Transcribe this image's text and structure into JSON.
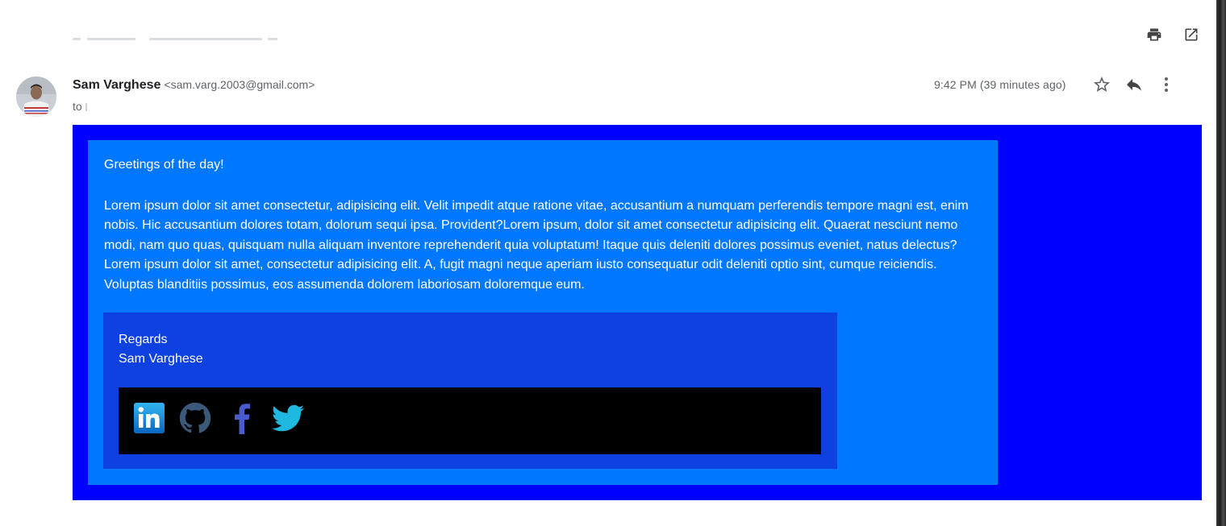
{
  "sender": {
    "name": "Sam Varghese",
    "email": "<sam.varg.2003@gmail.com>",
    "to_label": "to"
  },
  "timestamp": "9:42 PM (39 minutes ago)",
  "toolbar": {
    "print_icon": "print-icon",
    "open_new_window_icon": "open-in-new-window-icon",
    "star_icon": "star-outline-icon",
    "reply_icon": "reply-icon",
    "more_icon": "more-vertical-icon"
  },
  "email": {
    "greeting": "Greetings of the day!",
    "paragraph": "Lorem ipsum dolor sit amet consectetur, adipisicing elit. Velit impedit atque ratione vitae, accusantium a numquam perferendis tempore magni est, enim nobis. Hic accusantium dolores totam, dolorum sequi ipsa. Provident?Lorem ipsum, dolor sit amet consectetur adipisicing elit. Quaerat nesciunt nemo modi, nam quo quas, quisquam nulla aliquam inventore reprehenderit quia voluptatum! Itaque quis deleniti dolores possimus eveniet, natus delectus? Lorem ipsum dolor sit amet, consectetur adipisicing elit. A, fugit magni neque aperiam iusto consequatur odit deleniti optio sint, cumque reiciendis. Voluptas blanditiis possimus, eos assumenda dolorem laboriosam doloremque eum.",
    "regards": "Regards",
    "signature_name": "Sam Varghese"
  },
  "social_links": [
    {
      "icon": "linkedin-icon",
      "color": "#0a66c2"
    },
    {
      "icon": "github-icon",
      "color": "#3b5a7a"
    },
    {
      "icon": "facebook-icon",
      "color": "#4a5bd0"
    },
    {
      "icon": "twitter-icon",
      "color": "#1eb8e0"
    }
  ],
  "colors": {
    "outer_background": "#0000ff",
    "card_background": "#0077ff",
    "signature_background": "#0d41e1",
    "social_bar_background": "#000000"
  }
}
